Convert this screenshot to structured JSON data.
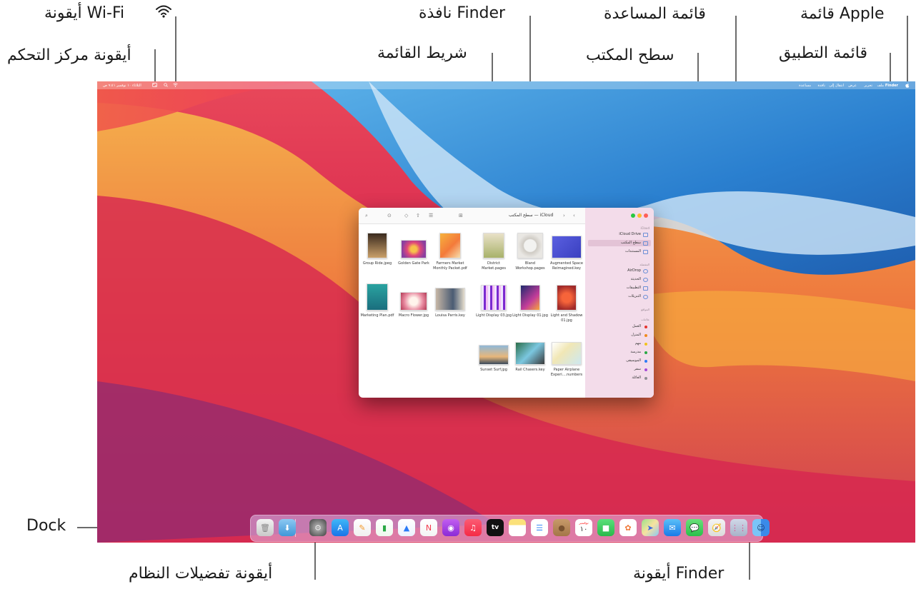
{
  "callouts": {
    "wifi_icon": "أيقونة Wi-Fi",
    "control_center_icon": "أيقونة مركز التحكم",
    "finder_window": "نافذة Finder",
    "menu_bar": "شريط القائمة",
    "help_menu": "قائمة المساعدة",
    "desktop": "سطح المكتب",
    "apple_menu": "قائمة Apple",
    "app_menu": "قائمة التطبيق",
    "dock": "Dock",
    "system_preferences_icon": "أيقونة تفضيلات النظام",
    "finder_icon": "أيقونة Finder"
  },
  "menubar": {
    "app_name": "Finder",
    "items": [
      "ملف",
      "تحرير",
      "عرض",
      "انتقال إلى",
      "نافذة",
      "مساعدة"
    ],
    "clock": "الثلاثاء ١٠ نوفمبر  ٩:٤١ ص"
  },
  "finder": {
    "title": "سطح المكتب — iCloud",
    "sidebar": {
      "icloud_heading": "iCloud",
      "icloud_items": [
        "iCloud Drive",
        "سطح المكتب",
        "المستندات"
      ],
      "favorites_heading": "المفضلة",
      "favorites_items": [
        "AirDrop",
        "الحديثة",
        "التطبيقات",
        "التنزيلات"
      ],
      "locations_heading": "المواقع",
      "tags_heading": "علامات",
      "tags": [
        {
          "label": "العمل",
          "color": "#e5322d"
        },
        {
          "label": "المنزل",
          "color": "#f08a1d"
        },
        {
          "label": "مهم",
          "color": "#f2c21b"
        },
        {
          "label": "مدرسة",
          "color": "#2aa845"
        },
        {
          "label": "الموسيقى",
          "color": "#2e7cf6"
        },
        {
          "label": "سفر",
          "color": "#a64bd6"
        },
        {
          "label": "العائلة",
          "color": "#8e8e93"
        }
      ]
    },
    "files": [
      "Group Ride.jpeg",
      "Golden Gate Park",
      "Farmers Market Monthly Packet.pdf",
      "District Market.pages",
      "Bland Workshop.pages",
      "Augmented Space Reimagined.key",
      "Marketing Plan.pdf",
      "Macro Flower.jpg",
      "Louisa Parris.key",
      "Light Display 03.jpg",
      "Light Display 01.jpg",
      "Light and Shadow 01.jpg",
      "Sunset Surf.jpg",
      "Rail Chasers.key",
      "Paper Airplane Experi....numbers"
    ]
  },
  "dock": {
    "items": [
      "trash-icon",
      "downloads-folder-icon",
      "system-preferences-icon",
      "app-store-icon",
      "pages-icon",
      "numbers-icon",
      "keynote-icon",
      "news-icon",
      "podcasts-icon",
      "music-icon",
      "tv-icon",
      "notes-icon",
      "reminders-icon",
      "contacts-icon",
      "calendar-icon",
      "facetime-icon",
      "photos-icon",
      "maps-icon",
      "mail-icon",
      "messages-icon",
      "safari-icon",
      "launchpad-icon",
      "finder-icon"
    ],
    "calendar_month": "نوفمبر",
    "calendar_day": "١٠",
    "tv_label": "tv"
  }
}
